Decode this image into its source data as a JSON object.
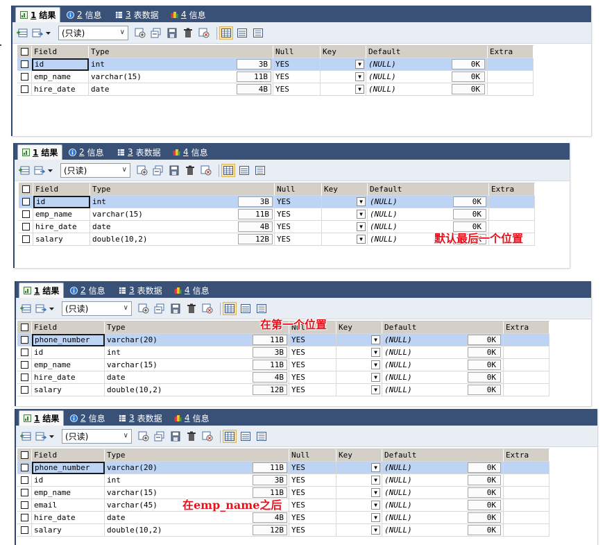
{
  "tabs": [
    {
      "num": "1",
      "label": "结果"
    },
    {
      "num": "2",
      "label": "信息"
    },
    {
      "num": "3",
      "label": "表数据"
    },
    {
      "num": "4",
      "label": "信息"
    }
  ],
  "toolbar": {
    "readonly_label": "(只读)"
  },
  "columns": [
    "Field",
    "Type",
    "Null",
    "Key",
    "Default",
    "Extra"
  ],
  "panels": [
    {
      "rows": [
        {
          "field": "id",
          "type": "int",
          "size": "3B",
          "null": "YES",
          "default": "(NULL)",
          "ok": "0K"
        },
        {
          "field": "emp_name",
          "type": "varchar(15)",
          "size": "11B",
          "null": "YES",
          "default": "(NULL)",
          "ok": "0K"
        },
        {
          "field": "hire_date",
          "type": "date",
          "size": "4B",
          "null": "YES",
          "default": "(NULL)",
          "ok": "0K"
        }
      ]
    },
    {
      "rows": [
        {
          "field": "id",
          "type": "int",
          "size": "3B",
          "null": "YES",
          "default": "(NULL)",
          "ok": "0K"
        },
        {
          "field": "emp_name",
          "type": "varchar(15)",
          "size": "11B",
          "null": "YES",
          "default": "(NULL)",
          "ok": "0K"
        },
        {
          "field": "hire_date",
          "type": "date",
          "size": "4B",
          "null": "YES",
          "default": "(NULL)",
          "ok": "0K"
        },
        {
          "field": "salary",
          "type": "double(10,2)",
          "size": "12B",
          "null": "YES",
          "default": "(NULL)",
          "ok": "0K"
        }
      ],
      "annotation": "默认最后一个位置"
    },
    {
      "rows": [
        {
          "field": "phone_number",
          "type": "varchar(20)",
          "size": "11B",
          "null": "YES",
          "default": "(NULL)",
          "ok": "0K"
        },
        {
          "field": "id",
          "type": "int",
          "size": "3B",
          "null": "YES",
          "default": "(NULL)",
          "ok": "0K"
        },
        {
          "field": "emp_name",
          "type": "varchar(15)",
          "size": "11B",
          "null": "YES",
          "default": "(NULL)",
          "ok": "0K"
        },
        {
          "field": "hire_date",
          "type": "date",
          "size": "4B",
          "null": "YES",
          "default": "(NULL)",
          "ok": "0K"
        },
        {
          "field": "salary",
          "type": "double(10,2)",
          "size": "12B",
          "null": "YES",
          "default": "(NULL)",
          "ok": "0K"
        }
      ],
      "annotation": "在第一个位置"
    },
    {
      "rows": [
        {
          "field": "phone_number",
          "type": "varchar(20)",
          "size": "11B",
          "null": "YES",
          "default": "(NULL)",
          "ok": "0K"
        },
        {
          "field": "id",
          "type": "int",
          "size": "3B",
          "null": "YES",
          "default": "(NULL)",
          "ok": "0K"
        },
        {
          "field": "emp_name",
          "type": "varchar(15)",
          "size": "11B",
          "null": "YES",
          "default": "(NULL)",
          "ok": "0K"
        },
        {
          "field": "email",
          "type": "varchar(45)",
          "size": "",
          "null": "YES",
          "default": "(NULL)",
          "ok": "0K"
        },
        {
          "field": "hire_date",
          "type": "date",
          "size": "4B",
          "null": "YES",
          "default": "(NULL)",
          "ok": "0K"
        },
        {
          "field": "salary",
          "type": "double(10,2)",
          "size": "12B",
          "null": "YES",
          "default": "(NULL)",
          "ok": "0K"
        }
      ],
      "annotation": "在emp_name之后"
    }
  ],
  "colors": {
    "tabbar": "#3a5177",
    "selected_row": "#bdd4f5",
    "header": "#d4d0c8",
    "annotation": "#e8121e"
  }
}
